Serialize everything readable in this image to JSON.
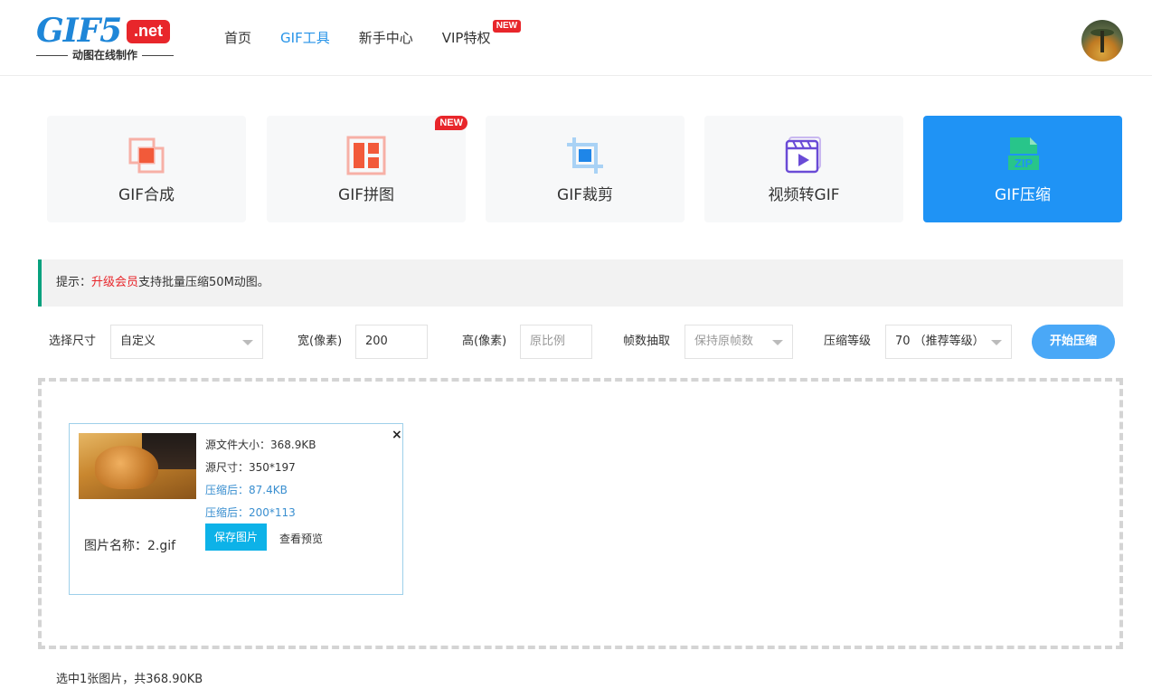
{
  "logo": {
    "main": "GIF5",
    "net": ".net",
    "sub": "动图在线制作"
  },
  "nav": {
    "items": [
      {
        "label": "首页"
      },
      {
        "label": "GIF工具"
      },
      {
        "label": "新手中心"
      },
      {
        "label": "VIP特权",
        "badge": "NEW"
      }
    ]
  },
  "tools": [
    {
      "label": "GIF合成"
    },
    {
      "label": "GIF拼图",
      "badge": "NEW"
    },
    {
      "label": "GIF裁剪"
    },
    {
      "label": "视频转GIF"
    },
    {
      "label": "GIF压缩",
      "icon_text": "ZIP"
    }
  ],
  "tip": {
    "prefix": "提示：",
    "link": "升级会员",
    "suffix": "支持批量压缩50M动图。"
  },
  "options": {
    "size_label": "选择尺寸",
    "size_value": "自定义",
    "width_label": "宽(像素)",
    "width_value": "200",
    "height_label": "高(像素)",
    "height_placeholder": "原比例",
    "frames_label": "帧数抽取",
    "frames_value": "保持原帧数",
    "level_label": "压缩等级",
    "level_value": "70 （推荐等级）",
    "start_button": "开始压缩"
  },
  "file": {
    "source_size": "源文件大小：368.9KB",
    "source_dims": "源尺寸：350*197",
    "compressed_size": "压缩后：87.4KB",
    "compressed_dims": "压缩后：200*113",
    "name": "图片名称：2.gif",
    "save_button": "保存图片",
    "preview_link": "查看预览",
    "close": "×"
  },
  "summary": "选中1张图片，共368.90KB",
  "colors": {
    "accent": "#1f93f5",
    "brand_red": "#e8262b",
    "tip_bar": "#07a17e"
  }
}
